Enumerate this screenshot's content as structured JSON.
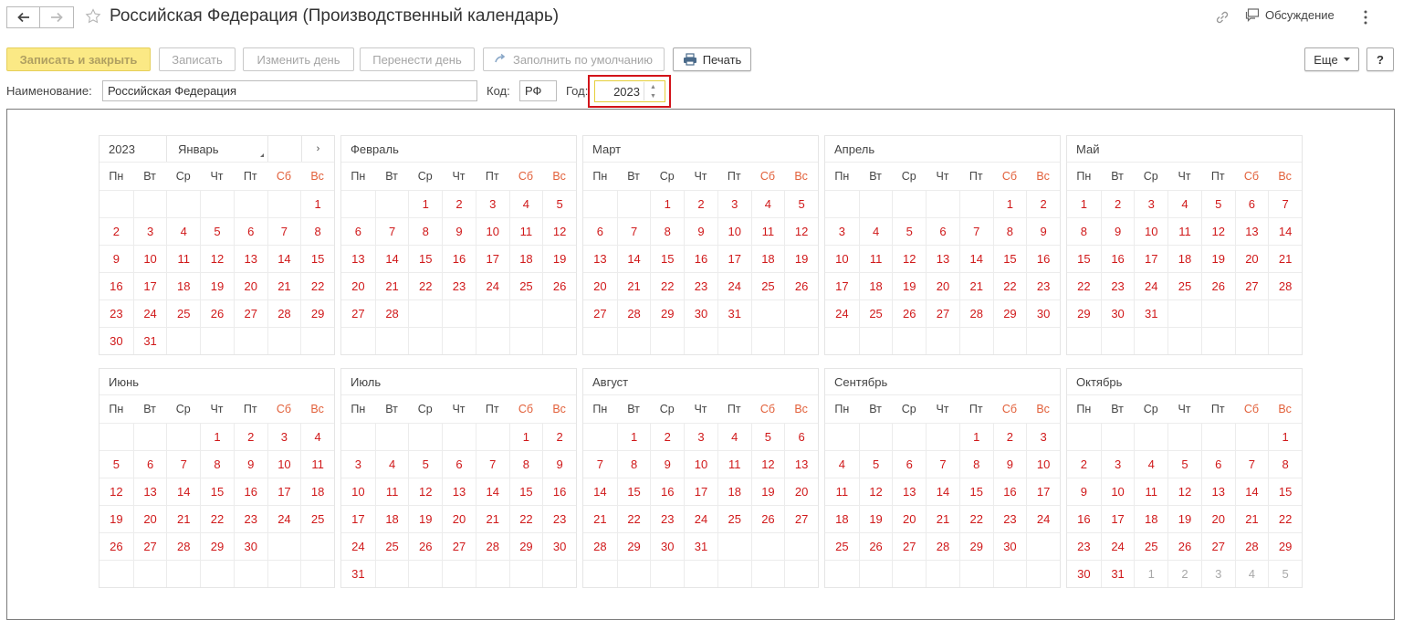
{
  "window": {
    "title": "Российская Федерация (Производственный календарь)",
    "discussion_label": "Обсуждение"
  },
  "toolbar": {
    "save_close": "Записать и закрыть",
    "save": "Записать",
    "edit_day": "Изменить день",
    "move_day": "Перенести день",
    "fill_default": "Заполнить по умолчанию",
    "print": "Печать",
    "more": "Еще",
    "help": "?"
  },
  "form": {
    "name_label": "Наименование:",
    "name_value": "Российская Федерация",
    "code_label": "Код:",
    "code_value": "РФ",
    "year_label": "Год:",
    "year_value": "2023"
  },
  "colors": {
    "day_red": "#d0191a",
    "weekend_header": "#e2603a",
    "primary_button": "#fbe985",
    "highlight_box": "#d2131a"
  },
  "icons": [
    "back-arrow-icon",
    "forward-arrow-icon",
    "star-icon",
    "link-icon",
    "discussion-icon",
    "more-vertical-icon",
    "fill-arrow-icon",
    "printer-icon",
    "chevron-down-icon",
    "chevron-right-icon"
  ],
  "calendar": {
    "header_year": "2023",
    "header_month": "Январь",
    "next_symbol": "›",
    "weekdays": [
      "Пн",
      "Вт",
      "Ср",
      "Чт",
      "Пт",
      "Сб",
      "Вс"
    ],
    "months": [
      {
        "name": "Январь",
        "weeks": [
          [
            "",
            "",
            "",
            "",
            "",
            "",
            "1"
          ],
          [
            "2",
            "3",
            "4",
            "5",
            "6",
            "7",
            "8"
          ],
          [
            "9",
            "10",
            "11",
            "12",
            "13",
            "14",
            "15"
          ],
          [
            "16",
            "17",
            "18",
            "19",
            "20",
            "21",
            "22"
          ],
          [
            "23",
            "24",
            "25",
            "26",
            "27",
            "28",
            "29"
          ],
          [
            "30",
            "31",
            "",
            "",
            "",
            "",
            ""
          ]
        ]
      },
      {
        "name": "Февраль",
        "weeks": [
          [
            "",
            "",
            "1",
            "2",
            "3",
            "4",
            "5"
          ],
          [
            "6",
            "7",
            "8",
            "9",
            "10",
            "11",
            "12"
          ],
          [
            "13",
            "14",
            "15",
            "16",
            "17",
            "18",
            "19"
          ],
          [
            "20",
            "21",
            "22",
            "23",
            "24",
            "25",
            "26"
          ],
          [
            "27",
            "28",
            "",
            "",
            "",
            "",
            ""
          ],
          [
            "",
            "",
            "",
            "",
            "",
            "",
            ""
          ]
        ]
      },
      {
        "name": "Март",
        "weeks": [
          [
            "",
            "",
            "1",
            "2",
            "3",
            "4",
            "5"
          ],
          [
            "6",
            "7",
            "8",
            "9",
            "10",
            "11",
            "12"
          ],
          [
            "13",
            "14",
            "15",
            "16",
            "17",
            "18",
            "19"
          ],
          [
            "20",
            "21",
            "22",
            "23",
            "24",
            "25",
            "26"
          ],
          [
            "27",
            "28",
            "29",
            "30",
            "31",
            "",
            ""
          ],
          [
            "",
            "",
            "",
            "",
            "",
            "",
            ""
          ]
        ]
      },
      {
        "name": "Апрель",
        "weeks": [
          [
            "",
            "",
            "",
            "",
            "",
            "1",
            "2"
          ],
          [
            "3",
            "4",
            "5",
            "6",
            "7",
            "8",
            "9"
          ],
          [
            "10",
            "11",
            "12",
            "13",
            "14",
            "15",
            "16"
          ],
          [
            "17",
            "18",
            "19",
            "20",
            "21",
            "22",
            "23"
          ],
          [
            "24",
            "25",
            "26",
            "27",
            "28",
            "29",
            "30"
          ],
          [
            "",
            "",
            "",
            "",
            "",
            "",
            ""
          ]
        ]
      },
      {
        "name": "Май",
        "weeks": [
          [
            "1",
            "2",
            "3",
            "4",
            "5",
            "6",
            "7"
          ],
          [
            "8",
            "9",
            "10",
            "11",
            "12",
            "13",
            "14"
          ],
          [
            "15",
            "16",
            "17",
            "18",
            "19",
            "20",
            "21"
          ],
          [
            "22",
            "23",
            "24",
            "25",
            "26",
            "27",
            "28"
          ],
          [
            "29",
            "30",
            "31",
            "",
            "",
            "",
            ""
          ],
          [
            "",
            "",
            "",
            "",
            "",
            "",
            ""
          ]
        ]
      },
      {
        "name": "Июнь",
        "weeks": [
          [
            "",
            "",
            "",
            "1",
            "2",
            "3",
            "4"
          ],
          [
            "5",
            "6",
            "7",
            "8",
            "9",
            "10",
            "11"
          ],
          [
            "12",
            "13",
            "14",
            "15",
            "16",
            "17",
            "18"
          ],
          [
            "19",
            "20",
            "21",
            "22",
            "23",
            "24",
            "25"
          ],
          [
            "26",
            "27",
            "28",
            "29",
            "30",
            "",
            ""
          ],
          [
            "",
            "",
            "",
            "",
            "",
            "",
            ""
          ]
        ]
      },
      {
        "name": "Июль",
        "weeks": [
          [
            "",
            "",
            "",
            "",
            "",
            "1",
            "2"
          ],
          [
            "3",
            "4",
            "5",
            "6",
            "7",
            "8",
            "9"
          ],
          [
            "10",
            "11",
            "12",
            "13",
            "14",
            "15",
            "16"
          ],
          [
            "17",
            "18",
            "19",
            "20",
            "21",
            "22",
            "23"
          ],
          [
            "24",
            "25",
            "26",
            "27",
            "28",
            "29",
            "30"
          ],
          [
            "31",
            "",
            "",
            "",
            "",
            "",
            ""
          ]
        ]
      },
      {
        "name": "Август",
        "weeks": [
          [
            "",
            "1",
            "2",
            "3",
            "4",
            "5",
            "6"
          ],
          [
            "7",
            "8",
            "9",
            "10",
            "11",
            "12",
            "13"
          ],
          [
            "14",
            "15",
            "16",
            "17",
            "18",
            "19",
            "20"
          ],
          [
            "21",
            "22",
            "23",
            "24",
            "25",
            "26",
            "27"
          ],
          [
            "28",
            "29",
            "30",
            "31",
            "",
            "",
            ""
          ],
          [
            "",
            "",
            "",
            "",
            "",
            "",
            ""
          ]
        ]
      },
      {
        "name": "Сентябрь",
        "weeks": [
          [
            "",
            "",
            "",
            "",
            "1",
            "2",
            "3"
          ],
          [
            "4",
            "5",
            "6",
            "7",
            "8",
            "9",
            "10"
          ],
          [
            "11",
            "12",
            "13",
            "14",
            "15",
            "16",
            "17"
          ],
          [
            "18",
            "19",
            "20",
            "21",
            "22",
            "23",
            "24"
          ],
          [
            "25",
            "26",
            "27",
            "28",
            "29",
            "30",
            ""
          ],
          [
            "",
            "",
            "",
            "",
            "",
            "",
            ""
          ]
        ]
      },
      {
        "name": "Октябрь",
        "weeks": [
          [
            "",
            "",
            "",
            "",
            "",
            "",
            "1"
          ],
          [
            "2",
            "3",
            "4",
            "5",
            "6",
            "7",
            "8"
          ],
          [
            "9",
            "10",
            "11",
            "12",
            "13",
            "14",
            "15"
          ],
          [
            "16",
            "17",
            "18",
            "19",
            "20",
            "21",
            "22"
          ],
          [
            "23",
            "24",
            "25",
            "26",
            "27",
            "28",
            "29"
          ],
          [
            "30",
            "31",
            "1",
            "2",
            "3",
            "4",
            "5"
          ]
        ],
        "other_month_from": [
          5,
          2
        ]
      }
    ]
  }
}
